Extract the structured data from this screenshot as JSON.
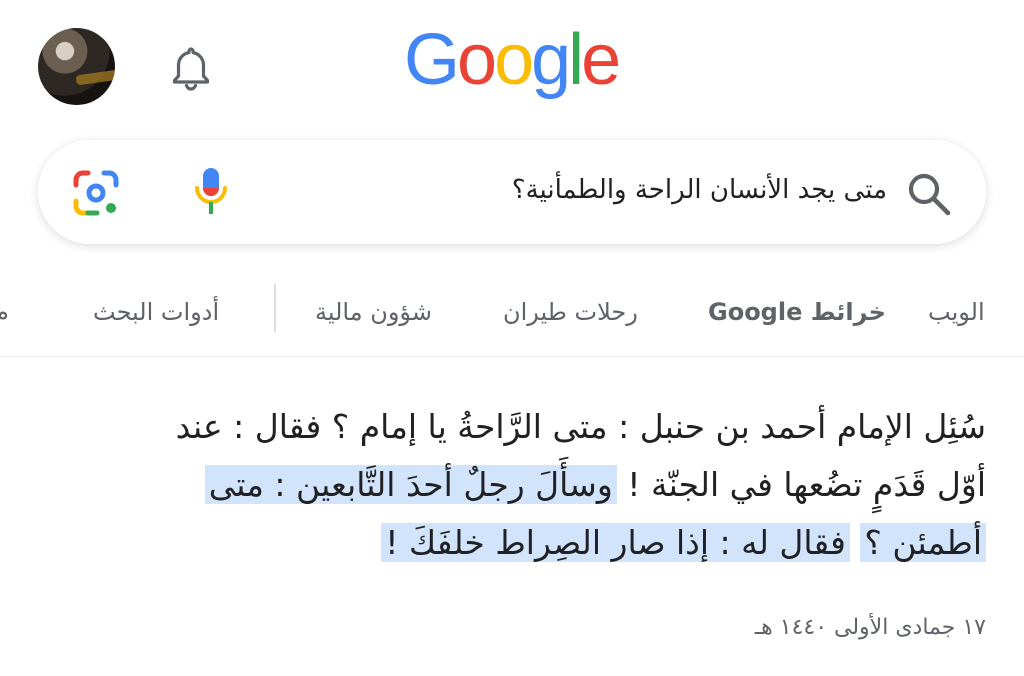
{
  "header": {
    "logo_letters": [
      "G",
      "o",
      "o",
      "g",
      "l",
      "e"
    ],
    "logo_colors": [
      "#4285F4",
      "#EA4335",
      "#FBBC05",
      "#4285F4",
      "#34A853",
      "#EA4335"
    ],
    "icons": {
      "avatar": "profile-avatar",
      "bell": "notifications-bell",
      "lens": "google-lens",
      "mic": "voice-search",
      "search": "magnifier"
    }
  },
  "search": {
    "query": "متى يجد الأنسان الراحة والطمأنية؟"
  },
  "tabs": {
    "web": "الويب",
    "maps": "خرائط Google",
    "flights": "رحلات طيران",
    "finance": "شؤون مالية",
    "tools": "أدوات البحث",
    "cut": "م"
  },
  "result": {
    "line1": "سُئِل الإمام أحمد بن حنبل : متى الرَّاحةُ يا إمام ؟ فقال : عند",
    "line2_plain": "أوّل قَدَمٍ تضُعها في الجنّة ! ",
    "line2_highlight": "وسأَلَ رجلٌ أحدَ التَّابعين : متى",
    "line3_highlight_a": "أطمئن ؟",
    "line3_highlight_b": "فقال له : إذا صار الصِراط خلفَكَ !",
    "date": "١٧ جمادى الأولى ١٤٤٠ هـ"
  },
  "colors": {
    "highlight": "#d2e3fc",
    "text": "#202124",
    "muted": "#5f6368"
  }
}
